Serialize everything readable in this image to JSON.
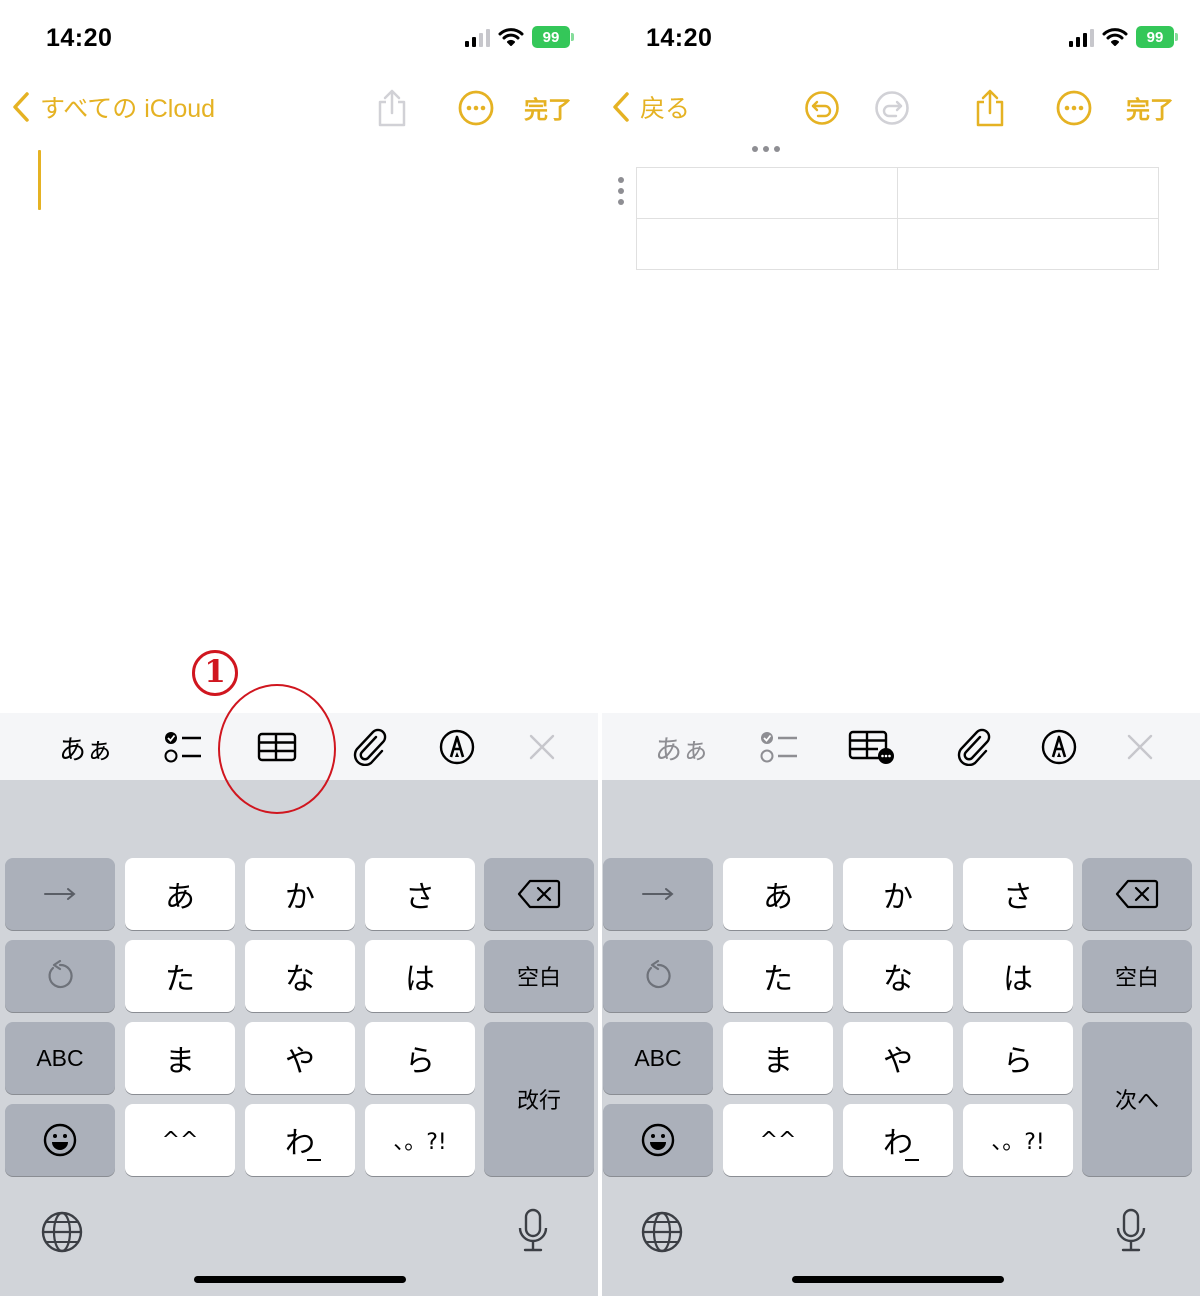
{
  "left": {
    "status": {
      "time": "14:20",
      "battery": "99"
    },
    "nav": {
      "back_label": "すべての iCloud",
      "done_label": "完了"
    },
    "toolbar": {
      "format_label": "あぁ"
    },
    "annotation": {
      "number": "①"
    }
  },
  "right": {
    "status": {
      "time": "14:20",
      "battery": "99"
    },
    "nav": {
      "back_label": "戻る",
      "done_label": "完了"
    },
    "toolbar": {
      "format_label": "あぁ"
    },
    "table": {
      "rows": 2,
      "columns": 2
    }
  },
  "keyboard": {
    "arrow": "→",
    "row1": [
      "あ",
      "か",
      "さ"
    ],
    "row2": [
      "た",
      "な",
      "は"
    ],
    "row3": [
      "ま",
      "や",
      "ら"
    ],
    "row4": [
      "^^",
      "わ",
      "、。?!"
    ],
    "space_label": "空白",
    "abc_label": "ABC",
    "return_left": "改行",
    "return_right": "次へ"
  },
  "colors": {
    "accent": "#e5b223",
    "annotation": "#d0161f",
    "battery": "#34c759"
  },
  "icons": [
    "chevron-left-icon",
    "share-icon",
    "more-icon",
    "undo-icon",
    "redo-icon",
    "checklist-icon",
    "table-icon",
    "paperclip-icon",
    "markup-icon",
    "close-icon",
    "delete-icon",
    "reload-icon",
    "emoji-icon",
    "globe-icon",
    "mic-icon"
  ]
}
